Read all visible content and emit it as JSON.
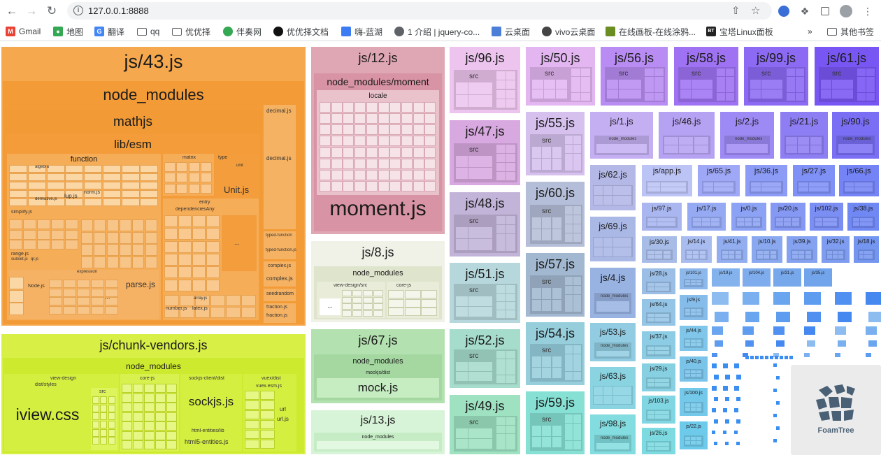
{
  "browser": {
    "url": "127.0.0.1:8888",
    "bookmarks": [
      {
        "label": "Gmail",
        "icon": "gmail-icon"
      },
      {
        "label": "地图",
        "icon": "maps-icon"
      },
      {
        "label": "翻译",
        "icon": "translate-icon"
      },
      {
        "label": "qq",
        "icon": "folder-icon"
      },
      {
        "label": "优优择",
        "icon": "folder-icon"
      },
      {
        "label": "伴奏网",
        "icon": "site-icon"
      },
      {
        "label": "优优择文档",
        "icon": "site-icon"
      },
      {
        "label": "嗨-蓝湖",
        "icon": "site-icon"
      },
      {
        "label": "1 介绍 | jquery-co...",
        "icon": "globe-icon"
      },
      {
        "label": "云桌面",
        "icon": "site-icon"
      },
      {
        "label": "vivo云桌面",
        "icon": "site-icon"
      },
      {
        "label": "在线画板-在线涂鸦...",
        "icon": "site-icon"
      },
      {
        "label": "宝塔Linux面板",
        "icon": "site-icon"
      }
    ],
    "more_label": "»",
    "other_bookmarks": "其他书签"
  },
  "sidebar_toggle": ">",
  "foamtree_label": "FoamTree",
  "groups": {
    "g43": {
      "title": "js/43.js",
      "nm": "node_modules",
      "mathjs": "mathjs",
      "libesm": "lib/esm",
      "function": "function",
      "unitjs": "Unit.js",
      "parsejs": "parse.js",
      "decimal_dir": "decimal.js",
      "decimal_file": "decimal.js",
      "typed": "typed-function",
      "typedjs": "typed-function.js",
      "complex": "complex.js",
      "complexjs": "complex.js",
      "seedrandom": "seedrandom",
      "fraction": "fraction.js",
      "fractionjs": "fraction.js",
      "matrix": "matrix",
      "type": "type",
      "unit": "unit",
      "entry": "entry",
      "deps": "dependenciesAny",
      "algebra": "algebra",
      "simplify": "simplify.js",
      "derivative": "derivative.js",
      "lup": "lup.js",
      "normjs": "norm.js",
      "range": "range.js",
      "subset": "subset.js",
      "qrjs": "qr.js",
      "nodejs": "Node.js",
      "number": "number.js",
      "latex": "latex.js",
      "array": "array.js",
      "expression": "expression",
      "dots": "..."
    },
    "chunk": {
      "title": "js/chunk-vendors.js",
      "nm": "node_modules",
      "viewdesign": "view-design",
      "diststyles": "dist/styles",
      "iview": "iview.css",
      "src": "src",
      "corejs": "core-js",
      "sockjs_dir": "sockjs-client/dist",
      "sockjs": "sockjs.js",
      "vuex": "vuex/dist",
      "vuexjs": "vuex.esm.js",
      "html": "html-entities/lib",
      "htmljs": "html5-entities.js",
      "url": "url",
      "urljs": "url.js",
      "dots": "..."
    },
    "g12": {
      "title": "js/12.js",
      "nm": "node_modules/moment",
      "locale": "locale",
      "moment": "moment.js"
    },
    "g8": {
      "title": "js/8.js",
      "nm": "node_modules",
      "vd": "view-design/src",
      "corejs": "core-js",
      "dots": "..."
    },
    "g67": {
      "title": "js/67.js",
      "nm": "node_modules",
      "mockdist": "mockjs/dist",
      "mock": "mock.js"
    },
    "g13": {
      "title": "js/13.js",
      "nm": "node_modules"
    }
  },
  "modules": {
    "c96": "js/96.js",
    "c47": "js/47.js",
    "c48": "js/48.js",
    "c51": "js/51.js",
    "c52": "js/52.js",
    "c49": "js/49.js",
    "c50": "js/50.js",
    "c55": "js/55.js",
    "c60": "js/60.js",
    "c57": "js/57.js",
    "c54": "js/54.js",
    "c59": "js/59.js",
    "c56": "js/56.js",
    "c58": "js/58.js",
    "c99": "js/99.js",
    "c61": "js/61.js",
    "c1": "js/1.js",
    "c46": "js/46.js",
    "c2": "js/2.js",
    "c21": "js/21.js",
    "c90": "js/90.js",
    "c62": "js/62.js",
    "capp": "js/app.js",
    "c65": "js/65.js",
    "c36": "js/36.js",
    "c27": "js/27.js",
    "c66": "js/66.js",
    "c69": "js/69.js",
    "c97": "js/97.js",
    "c17": "js/17.js",
    "c0": "js/0.js",
    "c20": "js/20.js",
    "c102": "js/102.js",
    "c38": "js/38.js",
    "c4": "js/4.js",
    "c30": "js/30.js",
    "c14": "js/14.js",
    "c41": "js/41.js",
    "c10": "js/10.js",
    "c39": "js/39.js",
    "c32": "js/32.js",
    "c18": "js/18.js",
    "c53": "js/53.js",
    "c28": "js/28.js",
    "c101": "js/101.js",
    "c19": "js/19.js",
    "c104": "js/104.js",
    "c31": "js/31.js",
    "c35": "js/35.js",
    "c63": "js/63.js",
    "c64": "js/64.js",
    "c9": "js/9.js",
    "c98": "js/98.js",
    "c37": "js/37.js",
    "c44": "js/44.js",
    "c29": "js/29.js",
    "c40": "js/40.js",
    "c103": "js/103.js",
    "c100": "js/100.js",
    "c26": "js/26.js",
    "c22": "js/22.js"
  },
  "inner": {
    "src": "src",
    "nm": "node_modules",
    "dots": "..."
  }
}
